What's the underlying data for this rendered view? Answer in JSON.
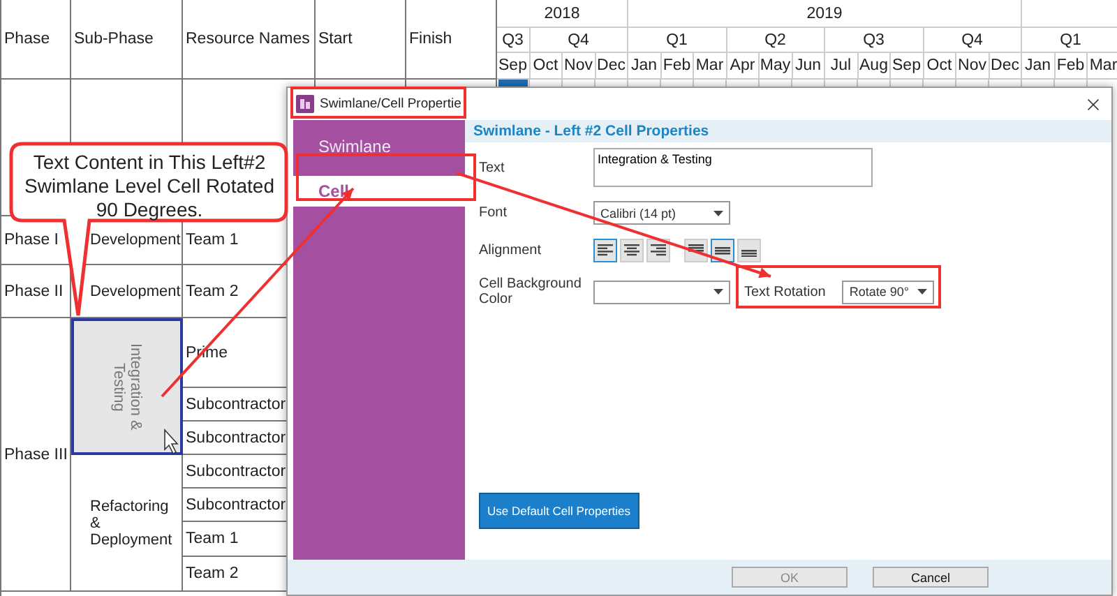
{
  "table": {
    "columns": [
      "Phase",
      "Sub-Phase",
      "Resource Names",
      "Start",
      "Finish"
    ],
    "years": [
      {
        "label": "2018",
        "quarters": [
          {
            "label": "Q3",
            "months": [
              "Sep"
            ]
          },
          {
            "label": "Q4",
            "months": [
              "Oct",
              "Nov",
              "Dec"
            ]
          }
        ]
      },
      {
        "label": "2019",
        "quarters": [
          {
            "label": "Q1",
            "months": [
              "Jan",
              "Feb",
              "Mar"
            ]
          },
          {
            "label": "Q2",
            "months": [
              "Apr",
              "May",
              "Jun"
            ]
          },
          {
            "label": "Q3",
            "months": [
              "Jul",
              "Aug",
              "Sep"
            ]
          },
          {
            "label": "Q4",
            "months": [
              "Oct",
              "Nov",
              "Dec"
            ]
          }
        ]
      },
      {
        "quarters": [
          {
            "label": "Q1",
            "months": [
              "Jan",
              "Feb",
              "Mar"
            ]
          }
        ]
      }
    ],
    "phases": [
      {
        "sub_phases": [
          {
            "selected": false
          }
        ]
      },
      {
        "name": "Phase I",
        "sub_phases": [
          {
            "name": "Development",
            "selected": false,
            "rotated": false,
            "resources": [
              {
                "name": "Team 1"
              }
            ]
          }
        ]
      },
      {
        "name": "Phase II",
        "sub_phases": [
          {
            "name": "Development",
            "selected": false,
            "rotated": false,
            "resources": [
              {
                "name": "Team 2"
              }
            ]
          }
        ]
      },
      {
        "name": "Phase III",
        "sub_phases": [
          {
            "name": "Integration & Testing",
            "selected": true,
            "rotated": true,
            "resources": [
              {
                "name": "Prime"
              },
              {
                "name": "Subcontractor"
              },
              {
                "name": "Subcontractor"
              }
            ]
          },
          {
            "name": "Refactoring & Deployment",
            "selected": false,
            "rotated": false,
            "resources": [
              {
                "name": "Subcontractor"
              },
              {
                "name": "Subcontractor"
              },
              {
                "name": "Team 1"
              },
              {
                "name": "Team 2"
              }
            ]
          }
        ]
      }
    ]
  },
  "callout": {
    "text": "Text Content in This Left#2 Swimlane Level Cell Rotated 90 Degrees."
  },
  "dialog": {
    "title": "Swimlane/Cell Propertie",
    "nav": [
      {
        "label": "Swimlane",
        "selected": false
      },
      {
        "label": "Cell",
        "selected": true
      }
    ],
    "heading": "Swimlane - Left #2 Cell Properties",
    "text_label": "Text",
    "text_value": "Integration & Testing",
    "font_label": "Font",
    "font_value": "Calibri (14 pt)",
    "alignment_label": "Alignment",
    "horizontal_alignment": [
      {
        "selected": true
      },
      {
        "selected": false
      },
      {
        "selected": false
      }
    ],
    "vertical_alignment": [
      {
        "selected": false
      },
      {
        "selected": true
      },
      {
        "selected": false
      }
    ],
    "background_label": "Cell Background Color",
    "rotation_label": "Text Rotation",
    "rotation_value": "Rotate 90°",
    "default_button": "Use Default Cell Properties",
    "ok_button": {
      "label": "OK",
      "disabled": true
    },
    "cancel_button": {
      "label": "Cancel",
      "disabled": false
    }
  }
}
